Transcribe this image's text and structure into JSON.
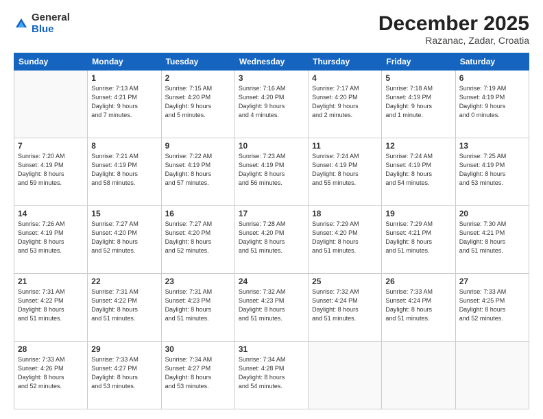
{
  "logo": {
    "general": "General",
    "blue": "Blue"
  },
  "header": {
    "month": "December 2025",
    "location": "Razanac, Zadar, Croatia"
  },
  "weekdays": [
    "Sunday",
    "Monday",
    "Tuesday",
    "Wednesday",
    "Thursday",
    "Friday",
    "Saturday"
  ],
  "weeks": [
    [
      {
        "day": "",
        "info": ""
      },
      {
        "day": "1",
        "info": "Sunrise: 7:13 AM\nSunset: 4:21 PM\nDaylight: 9 hours\nand 7 minutes."
      },
      {
        "day": "2",
        "info": "Sunrise: 7:15 AM\nSunset: 4:20 PM\nDaylight: 9 hours\nand 5 minutes."
      },
      {
        "day": "3",
        "info": "Sunrise: 7:16 AM\nSunset: 4:20 PM\nDaylight: 9 hours\nand 4 minutes."
      },
      {
        "day": "4",
        "info": "Sunrise: 7:17 AM\nSunset: 4:20 PM\nDaylight: 9 hours\nand 2 minutes."
      },
      {
        "day": "5",
        "info": "Sunrise: 7:18 AM\nSunset: 4:19 PM\nDaylight: 9 hours\nand 1 minute."
      },
      {
        "day": "6",
        "info": "Sunrise: 7:19 AM\nSunset: 4:19 PM\nDaylight: 9 hours\nand 0 minutes."
      }
    ],
    [
      {
        "day": "7",
        "info": "Sunrise: 7:20 AM\nSunset: 4:19 PM\nDaylight: 8 hours\nand 59 minutes."
      },
      {
        "day": "8",
        "info": "Sunrise: 7:21 AM\nSunset: 4:19 PM\nDaylight: 8 hours\nand 58 minutes."
      },
      {
        "day": "9",
        "info": "Sunrise: 7:22 AM\nSunset: 4:19 PM\nDaylight: 8 hours\nand 57 minutes."
      },
      {
        "day": "10",
        "info": "Sunrise: 7:23 AM\nSunset: 4:19 PM\nDaylight: 8 hours\nand 56 minutes."
      },
      {
        "day": "11",
        "info": "Sunrise: 7:24 AM\nSunset: 4:19 PM\nDaylight: 8 hours\nand 55 minutes."
      },
      {
        "day": "12",
        "info": "Sunrise: 7:24 AM\nSunset: 4:19 PM\nDaylight: 8 hours\nand 54 minutes."
      },
      {
        "day": "13",
        "info": "Sunrise: 7:25 AM\nSunset: 4:19 PM\nDaylight: 8 hours\nand 53 minutes."
      }
    ],
    [
      {
        "day": "14",
        "info": "Sunrise: 7:26 AM\nSunset: 4:19 PM\nDaylight: 8 hours\nand 53 minutes."
      },
      {
        "day": "15",
        "info": "Sunrise: 7:27 AM\nSunset: 4:20 PM\nDaylight: 8 hours\nand 52 minutes."
      },
      {
        "day": "16",
        "info": "Sunrise: 7:27 AM\nSunset: 4:20 PM\nDaylight: 8 hours\nand 52 minutes."
      },
      {
        "day": "17",
        "info": "Sunrise: 7:28 AM\nSunset: 4:20 PM\nDaylight: 8 hours\nand 51 minutes."
      },
      {
        "day": "18",
        "info": "Sunrise: 7:29 AM\nSunset: 4:20 PM\nDaylight: 8 hours\nand 51 minutes."
      },
      {
        "day": "19",
        "info": "Sunrise: 7:29 AM\nSunset: 4:21 PM\nDaylight: 8 hours\nand 51 minutes."
      },
      {
        "day": "20",
        "info": "Sunrise: 7:30 AM\nSunset: 4:21 PM\nDaylight: 8 hours\nand 51 minutes."
      }
    ],
    [
      {
        "day": "21",
        "info": "Sunrise: 7:31 AM\nSunset: 4:22 PM\nDaylight: 8 hours\nand 51 minutes."
      },
      {
        "day": "22",
        "info": "Sunrise: 7:31 AM\nSunset: 4:22 PM\nDaylight: 8 hours\nand 51 minutes."
      },
      {
        "day": "23",
        "info": "Sunrise: 7:31 AM\nSunset: 4:23 PM\nDaylight: 8 hours\nand 51 minutes."
      },
      {
        "day": "24",
        "info": "Sunrise: 7:32 AM\nSunset: 4:23 PM\nDaylight: 8 hours\nand 51 minutes."
      },
      {
        "day": "25",
        "info": "Sunrise: 7:32 AM\nSunset: 4:24 PM\nDaylight: 8 hours\nand 51 minutes."
      },
      {
        "day": "26",
        "info": "Sunrise: 7:33 AM\nSunset: 4:24 PM\nDaylight: 8 hours\nand 51 minutes."
      },
      {
        "day": "27",
        "info": "Sunrise: 7:33 AM\nSunset: 4:25 PM\nDaylight: 8 hours\nand 52 minutes."
      }
    ],
    [
      {
        "day": "28",
        "info": "Sunrise: 7:33 AM\nSunset: 4:26 PM\nDaylight: 8 hours\nand 52 minutes."
      },
      {
        "day": "29",
        "info": "Sunrise: 7:33 AM\nSunset: 4:27 PM\nDaylight: 8 hours\nand 53 minutes."
      },
      {
        "day": "30",
        "info": "Sunrise: 7:34 AM\nSunset: 4:27 PM\nDaylight: 8 hours\nand 53 minutes."
      },
      {
        "day": "31",
        "info": "Sunrise: 7:34 AM\nSunset: 4:28 PM\nDaylight: 8 hours\nand 54 minutes."
      },
      {
        "day": "",
        "info": ""
      },
      {
        "day": "",
        "info": ""
      },
      {
        "day": "",
        "info": ""
      }
    ]
  ]
}
